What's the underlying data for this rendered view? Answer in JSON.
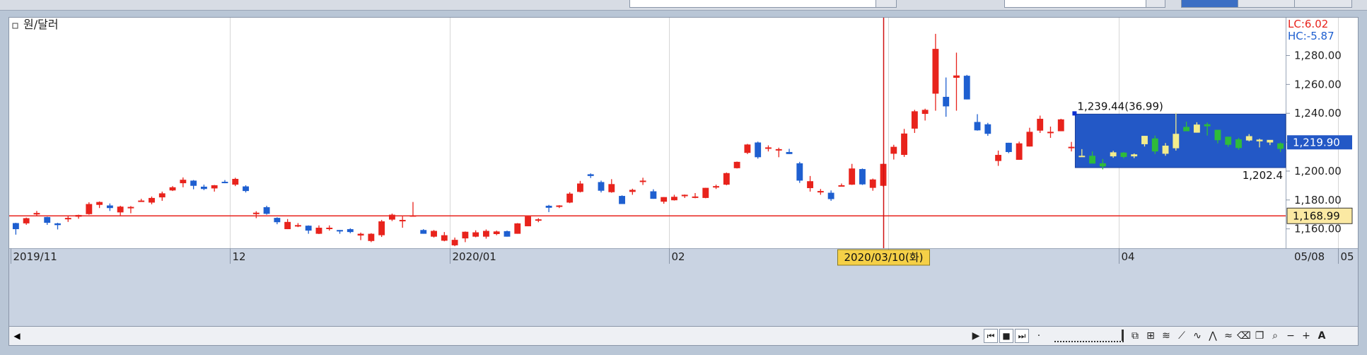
{
  "chart_data": {
    "type": "candlestick",
    "legend": "원/달러",
    "corner_labels": {
      "lc": "LC:6.02",
      "hc": "HC:-5.87"
    },
    "y_ticks": [
      "1,280.00",
      "1,260.00",
      "1,240.00",
      "1,220.00",
      "1,200.00",
      "1,180.00",
      "1,160.00"
    ],
    "y_tick_values": [
      1280,
      1260,
      1240,
      1220,
      1200,
      1180,
      1160
    ],
    "ylim": [
      1146.6,
      1306.2
    ],
    "x_labels": [
      "2019/11",
      "12",
      "2020/01",
      "02",
      "03",
      "04",
      "05",
      "05/08"
    ],
    "cursor_date": "2020/03/10(화)",
    "price_tags": {
      "current": "1,219.90",
      "hline": "1,168.99"
    },
    "hline_value": 1168.99,
    "selection": {
      "high_label": "1,239.44(36.99)",
      "low_label": "1,202.4",
      "high": 1239.44,
      "low": 1202.4
    },
    "colors": {
      "up": "#e8231c",
      "down": "#1e5fd0",
      "selection": "#2358c6",
      "up_in_selection": "#f3ec8c",
      "down_in_selection": "#2fbb3a",
      "hline": "#e8231c",
      "cursor": "#d01010"
    },
    "candles": [
      [
        1164,
        1164.2,
        1156,
        1159.8
      ],
      [
        1163.8,
        1167.8,
        1162.8,
        1167.4
      ],
      [
        1170,
        1172.4,
        1168.8,
        1171
      ],
      [
        1168.2,
        1168.4,
        1162.8,
        1164.2
      ],
      [
        1163.8,
        1164.2,
        1159.6,
        1162.6
      ],
      [
        1166.6,
        1169,
        1164.8,
        1167.6
      ],
      [
        1168.4,
        1169.8,
        1167,
        1169.6
      ],
      [
        1170.2,
        1178.4,
        1169.8,
        1177.2
      ],
      [
        1176.6,
        1179,
        1174.4,
        1178.6
      ],
      [
        1176.2,
        1177.6,
        1172.4,
        1174.4
      ],
      [
        1171.4,
        1176,
        1169.4,
        1175.4
      ],
      [
        1174.4,
        1175.8,
        1170.8,
        1175.2
      ],
      [
        1179.4,
        1180.8,
        1179.4,
        1179.6
      ],
      [
        1178.2,
        1182.4,
        1177,
        1181.4
      ],
      [
        1181.8,
        1185.8,
        1179.4,
        1184.6
      ],
      [
        1186.6,
        1189.6,
        1186.2,
        1188.8
      ],
      [
        1191.6,
        1195.6,
        1188.8,
        1194
      ],
      [
        1193.4,
        1193.8,
        1187.4,
        1189.8
      ],
      [
        1189.2,
        1190.6,
        1186.8,
        1187.6
      ],
      [
        1188,
        1190.4,
        1185.8,
        1190.2
      ],
      [
        1192.6,
        1193.8,
        1191.6,
        1192.4
      ],
      [
        1190.6,
        1195.4,
        1189.6,
        1194.6
      ],
      [
        1189.4,
        1190.2,
        1185.2,
        1186.2
      ],
      [
        1171,
        1172.2,
        1167.4,
        1171.2
      ],
      [
        1175,
        1176,
        1169.8,
        1170.4
      ],
      [
        1167.6,
        1168,
        1163.2,
        1164.6
      ],
      [
        1159.8,
        1166.8,
        1159.8,
        1164.8
      ],
      [
        1162.6,
        1164,
        1161.2,
        1162.6
      ],
      [
        1162.2,
        1162.4,
        1156.6,
        1158.8
      ],
      [
        1156.6,
        1162.4,
        1156.4,
        1160.8
      ],
      [
        1160.8,
        1162.4,
        1158.8,
        1160.8
      ],
      [
        1159.2,
        1159.2,
        1156.6,
        1158.2
      ],
      [
        1159.8,
        1160.4,
        1157,
        1157.8
      ],
      [
        1155.4,
        1157.4,
        1152.2,
        1156.6
      ],
      [
        1151.6,
        1157,
        1150.8,
        1156.6
      ],
      [
        1155.6,
        1166.2,
        1154.4,
        1165.2
      ],
      [
        1166.4,
        1170.6,
        1165.4,
        1169.8
      ],
      [
        1165.8,
        1168.6,
        1160.8,
        1166.2
      ],
      [
        1169.2,
        1178.6,
        1169.2,
        1169.4
      ],
      [
        1159.2,
        1159.8,
        1156.6,
        1156.6
      ],
      [
        1154.6,
        1159.2,
        1154,
        1158.6
      ],
      [
        1151.8,
        1157.8,
        1151.4,
        1155.6
      ],
      [
        1148.6,
        1154,
        1148,
        1152.4
      ],
      [
        1153.4,
        1158.2,
        1150.8,
        1158
      ],
      [
        1154.6,
        1159,
        1154.2,
        1157.6
      ],
      [
        1154.6,
        1159.6,
        1153.2,
        1158.6
      ],
      [
        1156.4,
        1158.8,
        1155.6,
        1158.2
      ],
      [
        1158.4,
        1158.8,
        1154.6,
        1154.6
      ],
      [
        1156.6,
        1164,
        1156.6,
        1163.8
      ],
      [
        1161.8,
        1168.8,
        1161.8,
        1168.6
      ],
      [
        1166.4,
        1167.4,
        1164.6,
        1166.6
      ],
      [
        1176,
        1176.6,
        1171.6,
        1174.6
      ],
      [
        1175.2,
        1176.4,
        1174.4,
        1176.2
      ],
      [
        1178.2,
        1185.4,
        1177.8,
        1184.4
      ],
      [
        1185.6,
        1193.2,
        1185.2,
        1191.4
      ],
      [
        1197.8,
        1198.4,
        1195.2,
        1196.6
      ],
      [
        1192.4,
        1193.4,
        1185.2,
        1186.4
      ],
      [
        1185.4,
        1194.4,
        1185,
        1191
      ],
      [
        1182.8,
        1183.2,
        1177.6,
        1177.2
      ],
      [
        1185.6,
        1187.8,
        1183.6,
        1187
      ],
      [
        1193.2,
        1195.4,
        1190.4,
        1193.4
      ],
      [
        1186,
        1187.4,
        1180.8,
        1180.8
      ],
      [
        1178.8,
        1182,
        1177.4,
        1182
      ],
      [
        1179.8,
        1183.6,
        1179.6,
        1182.2
      ],
      [
        1182.6,
        1183.8,
        1181.4,
        1183.6
      ],
      [
        1182.4,
        1184.8,
        1181.2,
        1182.4
      ],
      [
        1181.4,
        1188.4,
        1181.2,
        1188.4
      ],
      [
        1189.2,
        1190.6,
        1187.6,
        1189.6
      ],
      [
        1190.6,
        1199,
        1190.2,
        1198.6
      ],
      [
        1202,
        1206.6,
        1201.8,
        1206.4
      ],
      [
        1212.6,
        1218.8,
        1211.8,
        1218.4
      ],
      [
        1219.8,
        1220.4,
        1208.6,
        1209.6
      ],
      [
        1216.2,
        1217.8,
        1213.6,
        1216.4
      ],
      [
        1214.4,
        1216.2,
        1209.6,
        1215.2
      ],
      [
        1213.2,
        1215.4,
        1211.8,
        1211.8
      ],
      [
        1205.4,
        1206.4,
        1191.8,
        1193.4
      ],
      [
        1188.2,
        1196.6,
        1185.8,
        1193
      ],
      [
        1186.2,
        1187.6,
        1183.6,
        1186.2
      ],
      [
        1185,
        1186.6,
        1179.4,
        1180.6
      ],
      [
        1190,
        1191.4,
        1189.4,
        1190.2
      ],
      [
        1190.6,
        1205,
        1190.4,
        1201.8
      ],
      [
        1201.4,
        1201.8,
        1190.4,
        1190.8
      ],
      [
        1188.4,
        1194.8,
        1186.4,
        1194.2
      ],
      [
        1189.8,
        1205.2,
        1189.2,
        1205
      ],
      [
        1212,
        1218.2,
        1208,
        1216.8
      ],
      [
        1211.2,
        1229.2,
        1209.8,
        1226
      ],
      [
        1229.4,
        1242.4,
        1226.4,
        1241.4
      ],
      [
        1239.6,
        1243.2,
        1235,
        1242.4
      ],
      [
        1253.6,
        1295,
        1241.8,
        1284.6
      ],
      [
        1251.4,
        1264.8,
        1237.6,
        1244.8
      ],
      [
        1264.6,
        1282,
        1241.8,
        1266.2
      ],
      [
        1266,
        1266.6,
        1249.6,
        1249.6
      ],
      [
        1234,
        1239.4,
        1228,
        1228.2
      ],
      [
        1232.4,
        1233.4,
        1224.4,
        1225.8
      ],
      [
        1207,
        1214.2,
        1203.6,
        1211.2
      ],
      [
        1219.6,
        1219.6,
        1212.4,
        1213.2
      ],
      [
        1207.8,
        1220.4,
        1207.8,
        1219.2
      ],
      [
        1217,
        1230,
        1217,
        1227.2
      ],
      [
        1228,
        1238.4,
        1226.4,
        1236.2
      ],
      [
        1227,
        1230.8,
        1223,
        1227.2
      ],
      [
        1227.6,
        1236.2,
        1227.6,
        1235.8
      ],
      [
        1216.2,
        1220.2,
        1213.6,
        1216.8
      ],
      [
        1210.6,
        1215.2,
        1210.2,
        1210.6
      ],
      [
        1210.6,
        1213.6,
        1206.4,
        1205.2
      ],
      [
        1205.4,
        1208.4,
        1201.2,
        1203.2
      ],
      [
        1210.2,
        1214,
        1209.2,
        1213
      ],
      [
        1212.8,
        1213.2,
        1208.8,
        1209.8
      ],
      [
        1210.2,
        1212.2,
        1209,
        1211.6
      ],
      [
        1218.6,
        1224.4,
        1217,
        1224.4
      ],
      [
        1222.6,
        1224.6,
        1211.8,
        1213.6
      ],
      [
        1212,
        1219.4,
        1210.6,
        1217.6
      ],
      [
        1215.8,
        1240.4,
        1214.2,
        1225.8
      ],
      [
        1230.6,
        1234.2,
        1228.8,
        1227.6
      ],
      [
        1226.6,
        1233.8,
        1226.6,
        1232.2
      ],
      [
        1232.4,
        1233.6,
        1224.6,
        1231
      ],
      [
        1228.6,
        1228.6,
        1219.2,
        1221.4
      ],
      [
        1223.8,
        1223.8,
        1216.8,
        1218.2
      ],
      [
        1222,
        1223,
        1214.8,
        1216
      ],
      [
        1221.2,
        1225.6,
        1220.6,
        1224.2
      ],
      [
        1220.6,
        1222.4,
        1216.4,
        1221.8
      ],
      [
        1219.8,
        1220.2,
        1218,
        1221.6
      ],
      [
        1219.2,
        1219.8,
        1213.2,
        1215.4
      ]
    ]
  }
}
